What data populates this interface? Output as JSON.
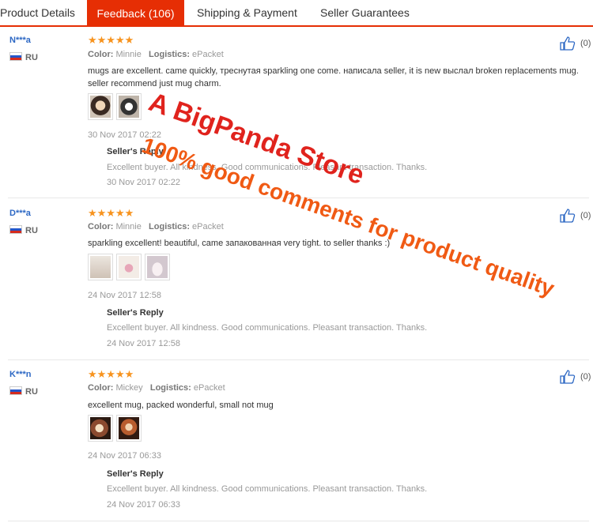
{
  "tabs": [
    {
      "label": "Product Details"
    },
    {
      "label": "Feedback (106)"
    },
    {
      "label": "Shipping & Payment"
    },
    {
      "label": "Seller Guarantees"
    }
  ],
  "reviews": [
    {
      "user": "N***a",
      "country": "RU",
      "stars": "★★★★★",
      "color_label": "Color:",
      "color_value": "Minnie",
      "logistics_label": "Logistics:",
      "logistics_value": "ePacket",
      "comment": "mugs are excellent. came quickly, треснутая sparkling one come. написала seller, it is new выслал broken replacements mug. seller recommend just mug charm.",
      "date": "30 Nov 2017 02:22",
      "reply_title": "Seller's Reply",
      "reply_text": "Excellent buyer. All kindness. Good communications. Pleasant transaction. Thanks.",
      "reply_date": "30 Nov 2017 02:22",
      "useful_count": "(0)"
    },
    {
      "user": "D***a",
      "country": "RU",
      "stars": "★★★★★",
      "color_label": "Color:",
      "color_value": "Minnie",
      "logistics_label": "Logistics:",
      "logistics_value": "ePacket",
      "comment": "sparkling excellent! beautiful, came запакованная very tight. to seller thanks :)",
      "date": "24 Nov 2017 12:58",
      "reply_title": "Seller's Reply",
      "reply_text": "Excellent buyer. All kindness. Good communications. Pleasant transaction. Thanks.",
      "reply_date": "24 Nov 2017 12:58",
      "useful_count": "(0)"
    },
    {
      "user": "K***n",
      "country": "RU",
      "stars": "★★★★★",
      "color_label": "Color:",
      "color_value": "Mickey",
      "logistics_label": "Logistics:",
      "logistics_value": "ePacket",
      "comment": "excellent mug, packed wonderful, small not mug",
      "date": "24 Nov 2017 06:33",
      "reply_title": "Seller's Reply",
      "reply_text": "Excellent buyer. All kindness. Good communications. Pleasant transaction. Thanks.",
      "reply_date": "24 Nov 2017 06:33",
      "useful_count": "(0)"
    }
  ],
  "watermark": {
    "line1": "A BigPanda Store",
    "line2": "100% good comments for product quality"
  },
  "colors": {
    "accent": "#e62e04",
    "star": "#f7931e",
    "username": "#2d68c4"
  }
}
